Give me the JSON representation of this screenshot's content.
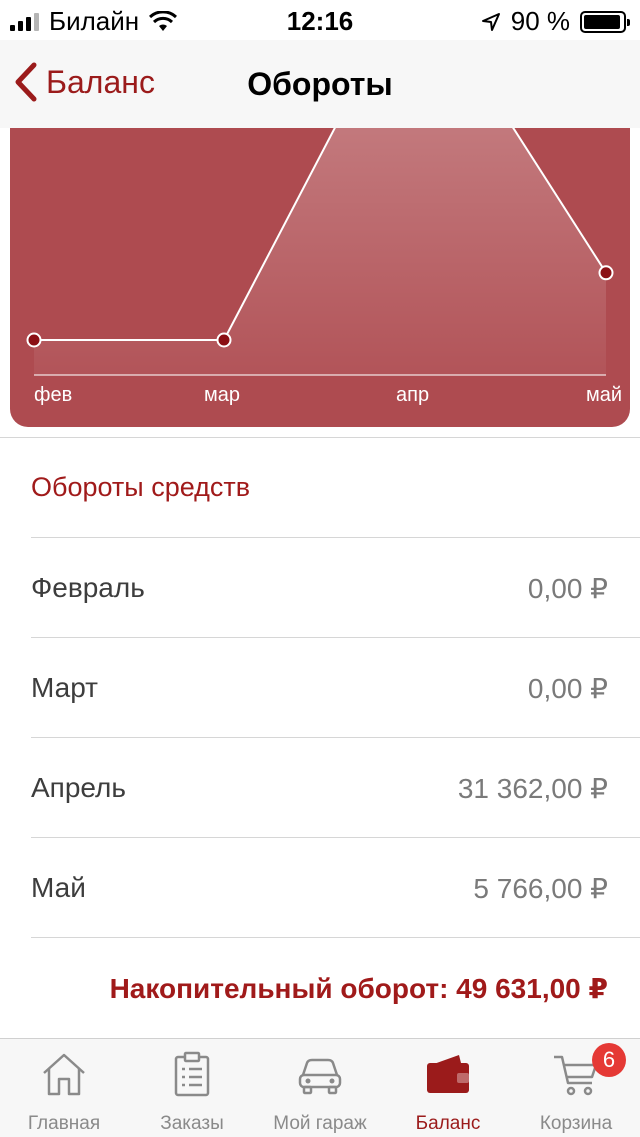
{
  "status_bar": {
    "carrier": "Билайн",
    "time": "12:16",
    "battery": "90 %",
    "signal_bars": 4,
    "signal_bars_active": 3
  },
  "nav": {
    "back_label": "Баланс",
    "title": "Обороты"
  },
  "chart_data": {
    "type": "area",
    "categories": [
      "фев",
      "мар",
      "апр",
      "май"
    ],
    "values": [
      0,
      0,
      31362,
      5766
    ],
    "color": "#ae4b50"
  },
  "section": {
    "title": "Обороты средств",
    "rows": [
      {
        "label": "Февраль",
        "value": "0,00 ₽"
      },
      {
        "label": "Март",
        "value": "0,00 ₽"
      },
      {
        "label": "Апрель",
        "value": "31 362,00 ₽"
      },
      {
        "label": "Май",
        "value": "5 766,00 ₽"
      }
    ],
    "total": "Накопительный оборот: 49 631,00 ₽"
  },
  "tabs": [
    {
      "label": "Главная",
      "icon": "home-icon"
    },
    {
      "label": "Заказы",
      "icon": "clipboard-icon"
    },
    {
      "label": "Мой гараж",
      "icon": "car-icon"
    },
    {
      "label": "Баланс",
      "icon": "wallet-icon",
      "active": true
    },
    {
      "label": "Корзина",
      "icon": "cart-icon",
      "badge": "6"
    }
  ],
  "colors": {
    "accent": "#9b1b1b",
    "chart_bg": "#ae4b50",
    "badge": "#e53935"
  }
}
